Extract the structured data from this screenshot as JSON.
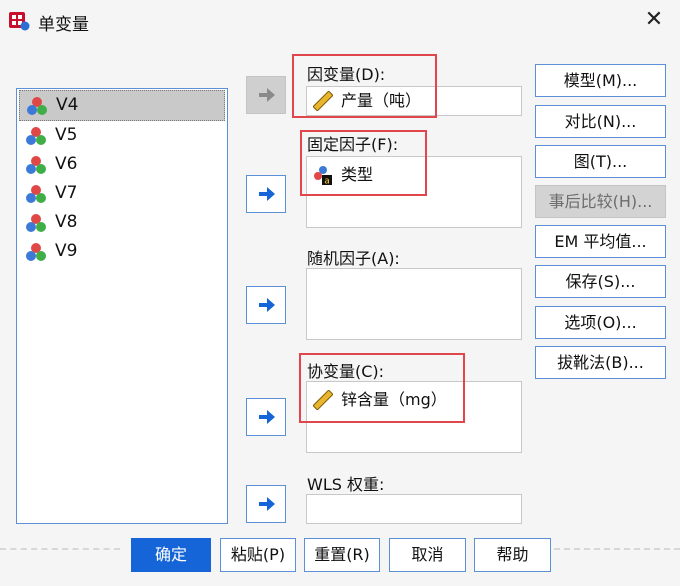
{
  "window": {
    "title": "单变量",
    "close_label": "✕"
  },
  "variables": [
    {
      "name": "V4",
      "selected": true
    },
    {
      "name": "V5",
      "selected": false
    },
    {
      "name": "V6",
      "selected": false
    },
    {
      "name": "V7",
      "selected": false
    },
    {
      "name": "V8",
      "selected": false
    },
    {
      "name": "V9",
      "selected": false
    }
  ],
  "fields": {
    "dependent": {
      "label": "因变量(D):",
      "value": "产量（吨）"
    },
    "fixed": {
      "label": "固定因子(F):",
      "value": "类型"
    },
    "random": {
      "label": "随机因子(A):"
    },
    "covariate": {
      "label": "协变量(C):",
      "value": "锌含量（mg）"
    },
    "wls": {
      "label": "WLS 权重:"
    }
  },
  "side_buttons": {
    "model": "模型(M)...",
    "contrast": "对比(N)...",
    "plot": "图(T)...",
    "posthoc": "事后比较(H)...",
    "em": "EM 平均值...",
    "save": "保存(S)...",
    "options": "选项(O)...",
    "bootstrap": "拔靴法(B)..."
  },
  "bottom_buttons": {
    "ok": "确定",
    "paste": "粘贴(P)",
    "reset": "重置(R)",
    "cancel": "取消",
    "help": "帮助"
  },
  "colors": {
    "accent": "#1565d8",
    "highlight": "#e0474c",
    "border": "#5b8fd6"
  }
}
